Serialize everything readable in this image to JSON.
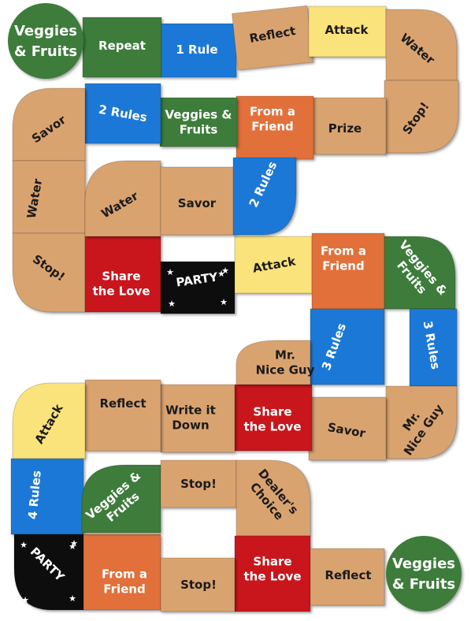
{
  "colors": {
    "tan": "#d9a36f",
    "green": "#3e7b3a",
    "blue": "#1f78d6",
    "orange": "#e1703a",
    "yellow": "#fbe37b",
    "red": "#c8181d",
    "black": "#0a0a0a",
    "dark_text": "#1b1b1b",
    "light_text": "#ffffff"
  },
  "start": {
    "label": [
      "Veggies",
      "& Fruits"
    ]
  },
  "finish": {
    "label": [
      "Veggies",
      "& Fruits"
    ]
  },
  "spaces": [
    {
      "label": [
        "Repeat"
      ],
      "color": "green"
    },
    {
      "label": [
        "1 Rule"
      ],
      "color": "blue"
    },
    {
      "label": [
        "Reflect"
      ],
      "color": "tan"
    },
    {
      "label": [
        "Attack"
      ],
      "color": "yellow"
    },
    {
      "label": [
        "Water"
      ],
      "color": "tan"
    },
    {
      "label": [
        "Stop!"
      ],
      "color": "tan"
    },
    {
      "label": [
        "Prize"
      ],
      "color": "tan"
    },
    {
      "label": [
        "From a",
        "Friend"
      ],
      "color": "orange"
    },
    {
      "label": [
        "Veggies &",
        "Fruits"
      ],
      "color": "green"
    },
    {
      "label": [
        "2 Rules"
      ],
      "color": "blue"
    },
    {
      "label": [
        "Savor"
      ],
      "color": "tan"
    },
    {
      "label": [
        "Water"
      ],
      "color": "tan"
    },
    {
      "label": [
        "Stop!"
      ],
      "color": "tan"
    },
    {
      "label": [
        "Share",
        "the Love"
      ],
      "color": "red"
    },
    {
      "label": [
        "PARTY"
      ],
      "color": "black",
      "stars": true
    },
    {
      "label": [
        "Attack"
      ],
      "color": "yellow"
    },
    {
      "label": [
        "From a",
        "Friend"
      ],
      "color": "orange"
    },
    {
      "label": [
        "Veggies &",
        "Fruits"
      ],
      "color": "green"
    },
    {
      "label": [
        "3 Rules"
      ],
      "color": "blue"
    },
    {
      "label": [
        "Mr.",
        "Nice Guy"
      ],
      "color": "tan"
    },
    {
      "label": [
        "Savor"
      ],
      "color": "tan"
    },
    {
      "label": [
        "Share",
        "the Love"
      ],
      "color": "red"
    },
    {
      "label": [
        "3 Rules"
      ],
      "color": "blue"
    },
    {
      "label": [
        "Mr.",
        "Nice Guy"
      ],
      "color": "tan"
    },
    {
      "label": [
        "Write it",
        "Down"
      ],
      "color": "tan"
    },
    {
      "label": [
        "Reflect"
      ],
      "color": "tan"
    },
    {
      "label": [
        "Attack"
      ],
      "color": "yellow"
    },
    {
      "label": [
        "4 Rules"
      ],
      "color": "blue"
    },
    {
      "label": [
        "PARTY"
      ],
      "color": "black",
      "stars": true
    },
    {
      "label": [
        "From a",
        "Friend"
      ],
      "color": "orange"
    },
    {
      "label": [
        "Veggies &",
        "Fruits"
      ],
      "color": "green"
    },
    {
      "label": [
        "Stop!"
      ],
      "color": "tan"
    },
    {
      "label": [
        "Dealer's",
        "Choice"
      ],
      "color": "tan"
    },
    {
      "label": [
        "Share",
        "the Love"
      ],
      "color": "red"
    },
    {
      "label": [
        "Stop!"
      ],
      "color": "tan"
    },
    {
      "label": [
        "Water"
      ],
      "color": "tan"
    },
    {
      "label": [
        "Savor"
      ],
      "color": "tan"
    },
    {
      "label": [
        "2 Rules"
      ],
      "color": "blue"
    },
    {
      "label": [
        "Share",
        "the Love"
      ],
      "color": "red"
    },
    {
      "label": [
        "Reflect"
      ],
      "color": "tan"
    }
  ]
}
